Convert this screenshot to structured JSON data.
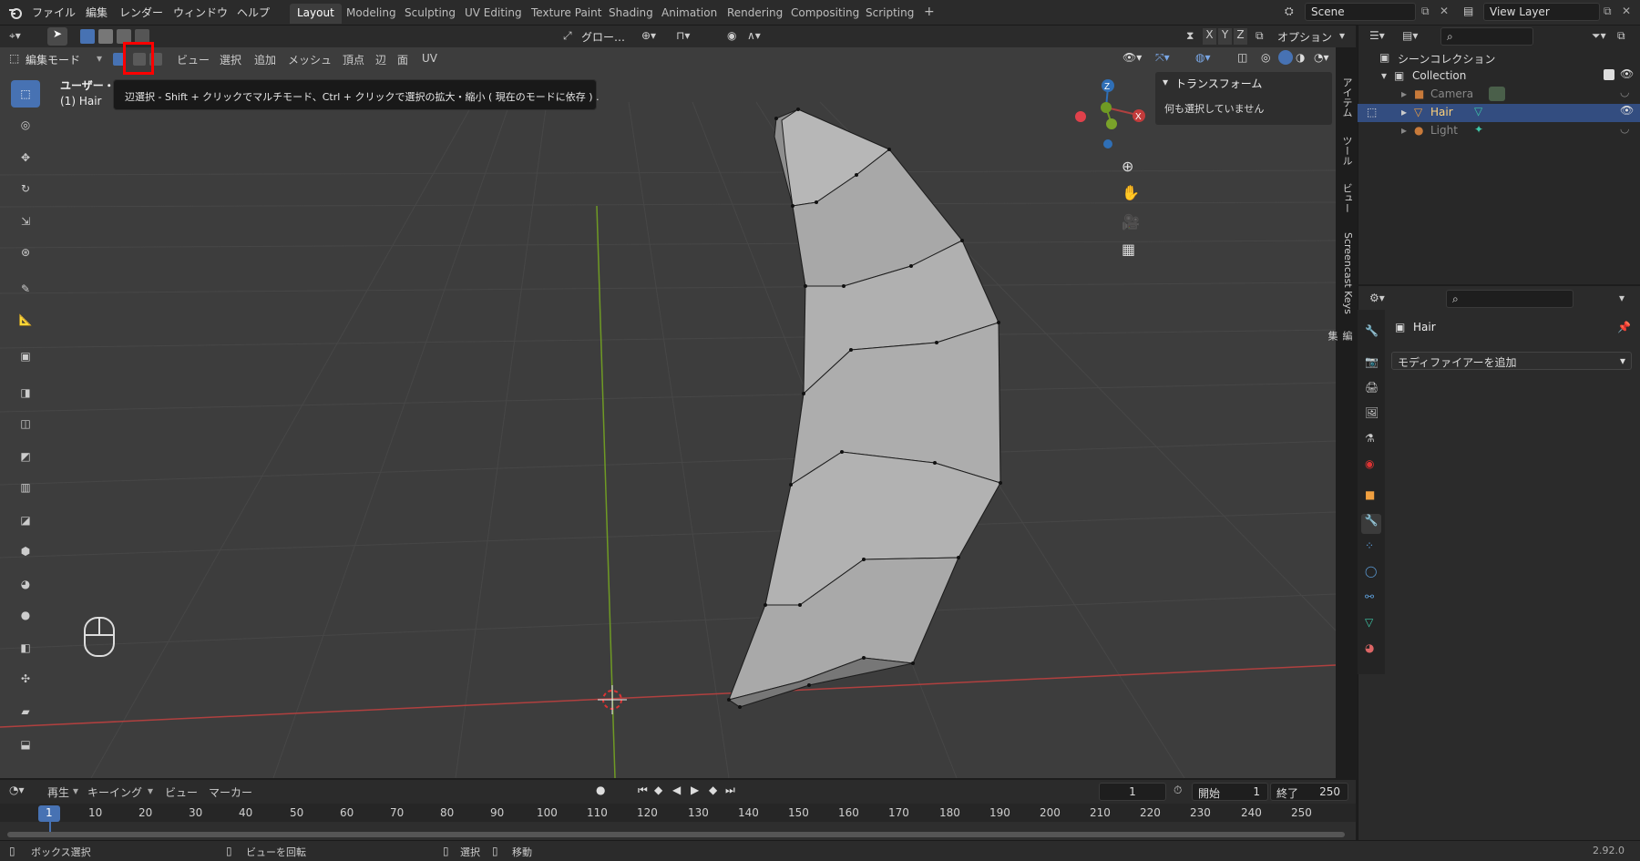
{
  "topbar": {
    "menus": [
      "ファイル",
      "編集",
      "レンダー",
      "ウィンドウ",
      "ヘルプ"
    ],
    "workspaces": [
      "Layout",
      "Modeling",
      "Sculpting",
      "UV Editing",
      "Texture Paint",
      "Shading",
      "Animation",
      "Rendering",
      "Compositing",
      "Scripting"
    ],
    "active_workspace": "Layout",
    "add_tab": "+",
    "scene": "Scene",
    "view_layer": "View Layer"
  },
  "tool_header": {
    "transform_orientation": "グロー…",
    "xyz": [
      "X",
      "Y",
      "Z"
    ],
    "options": "オプション"
  },
  "viewport_header": {
    "mode": "編集モード",
    "menus": [
      "ビュー",
      "選択",
      "追加",
      "メッシュ",
      "頂点",
      "辺",
      "面",
      "UV"
    ]
  },
  "viewport": {
    "view_label": "ユーザー・透",
    "object_label": "(1) Hair",
    "tooltip": "辺選択 - Shift + クリックでマルチモード、Ctrl + クリックで選択の拡大・縮小 ( 現在のモードに依存 ) ."
  },
  "npanel": {
    "header": "トランスフォーム",
    "empty": "何も選択していません"
  },
  "side_tabs": [
    "アイテム",
    "ツール",
    "ビュー",
    "Screencast Keys",
    "編集"
  ],
  "outliner": {
    "scene_collection": "シーンコレクション",
    "collection": "Collection",
    "items": [
      "Camera",
      "Hair",
      "Light"
    ]
  },
  "properties": {
    "object_name": "Hair",
    "add_modifier": "モディファイアーを追加"
  },
  "timeline": {
    "menus": [
      "再生",
      "キーイング",
      "ビュー",
      "マーカー"
    ],
    "current_frame": "1",
    "start_label": "開始",
    "start": "1",
    "end_label": "終了",
    "end": "250",
    "ticks": [
      "1",
      "10",
      "20",
      "30",
      "40",
      "50",
      "60",
      "70",
      "80",
      "90",
      "100",
      "110",
      "120",
      "130",
      "140",
      "150",
      "160",
      "170",
      "180",
      "190",
      "200",
      "210",
      "220",
      "230",
      "240",
      "250"
    ]
  },
  "statusbar": {
    "box_select": "ボックス選択",
    "rotate_view": "ビューを回転",
    "select": "選択",
    "move": "移動",
    "version": "2.92.0"
  },
  "colors": {
    "accent": "#4772b3",
    "highlight_box": "#ff0000",
    "x_axis": "#c23b3b",
    "y_axis": "#7aa32a",
    "z_axis": "#2f6fb6"
  }
}
